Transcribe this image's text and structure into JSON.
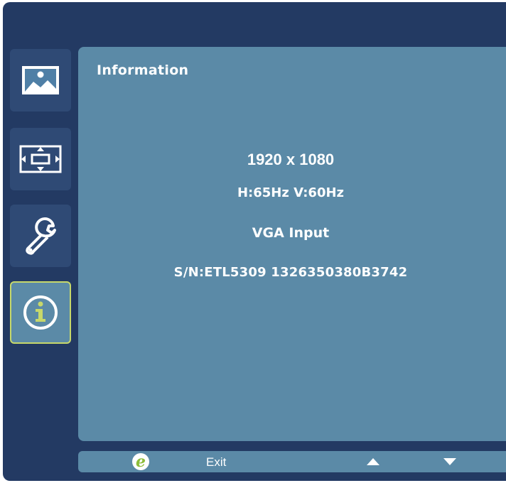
{
  "menu": {
    "tabs": [
      {
        "id": "picture",
        "icon": "picture-icon",
        "active": false
      },
      {
        "id": "display",
        "icon": "display-position-icon",
        "active": false
      },
      {
        "id": "settings",
        "icon": "wrench-icon",
        "active": false
      },
      {
        "id": "information",
        "icon": "info-icon",
        "active": true
      }
    ]
  },
  "panel": {
    "title": "Information",
    "resolution": "1920 x 1080",
    "frequency": "H:65Hz  V:60Hz",
    "input": "VGA Input",
    "serial": "S/N:ETL5309 1326350380B3742"
  },
  "footer": {
    "exit_icon": "e-logo-icon",
    "exit_label": "Exit",
    "up_icon": "up-arrow-icon",
    "down_icon": "down-arrow-icon"
  },
  "colors": {
    "frame": "#233a63",
    "tab": "#2f4a75",
    "panel": "#5b8aa7",
    "active_border": "#c7d86a",
    "exit_logo": "#8ebd3a"
  }
}
